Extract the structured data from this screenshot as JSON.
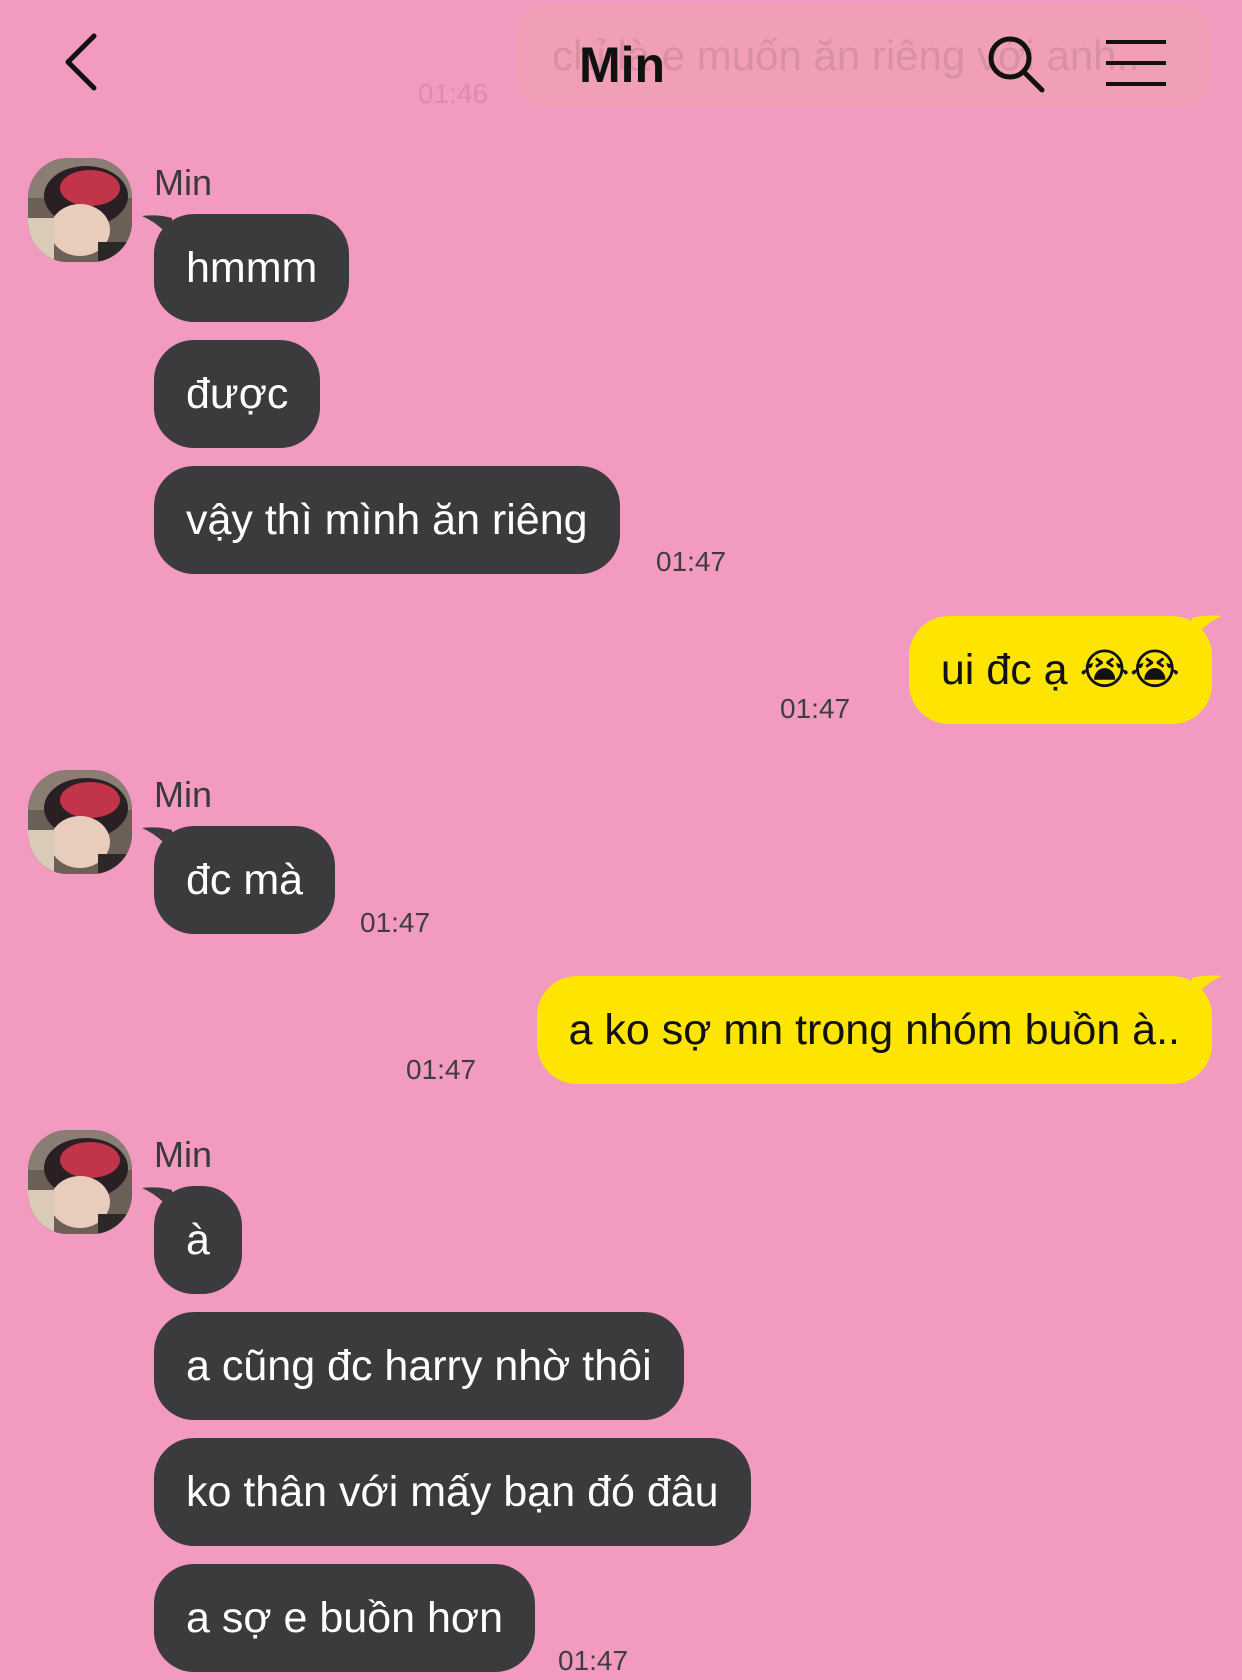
{
  "header": {
    "title": "Min",
    "ghost_preview": "chỉ là e muốn ăn riêng với anh..",
    "ghost_time": "01:46"
  },
  "groups": [
    {
      "sender": "Min",
      "messages": [
        "hmmm",
        "được",
        "vậy thì mình ăn riêng"
      ],
      "time": "01:47"
    },
    {
      "outgoing": true,
      "message": "ui đc ạ 😭😭",
      "time": "01:47"
    },
    {
      "sender": "Min",
      "messages": [
        "đc mà"
      ],
      "time": "01:47"
    },
    {
      "outgoing": true,
      "message": "a ko sợ mn trong nhóm buồn à..",
      "time": "01:47"
    },
    {
      "sender": "Min",
      "messages": [
        "à",
        "a cũng đc harry nhờ thôi",
        "ko thân với mấy bạn đó đâu",
        "a sợ e buồn hơn"
      ],
      "time": "01:47"
    }
  ],
  "colors": {
    "background": "#f29abf",
    "incoming_bubble": "#3b3b3d",
    "outgoing_bubble": "#fee500"
  },
  "icons": [
    "back-arrow-icon",
    "search-icon",
    "menu-icon"
  ]
}
